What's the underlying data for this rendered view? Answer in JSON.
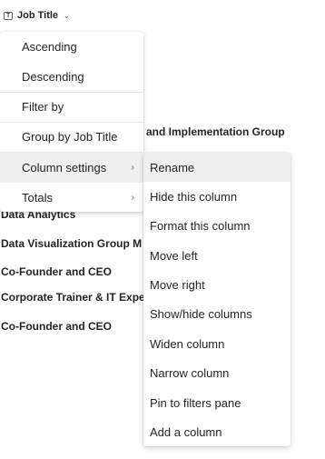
{
  "column_header": {
    "icon": "text-column-icon",
    "label": "Job Title",
    "chevron": "chevron-down-icon"
  },
  "rows": [
    "and Implementation Group",
    "Data Analytics",
    "Data Visualization Group M",
    "Co-Founder and CEO",
    "Corporate Trainer & IT Expe",
    "Co-Founder and CEO"
  ],
  "menu": {
    "ascending": "Ascending",
    "descending": "Descending",
    "filter_by": "Filter by",
    "group_by": "Group by Job Title",
    "column_settings": "Column settings",
    "totals": "Totals"
  },
  "submenu": {
    "rename": "Rename",
    "hide": "Hide this column",
    "format": "Format this column",
    "move_left": "Move left",
    "move_right": "Move right",
    "show_hide": "Show/hide columns",
    "widen": "Widen column",
    "narrow": "Narrow column",
    "pin": "Pin to filters pane",
    "add": "Add a column"
  }
}
